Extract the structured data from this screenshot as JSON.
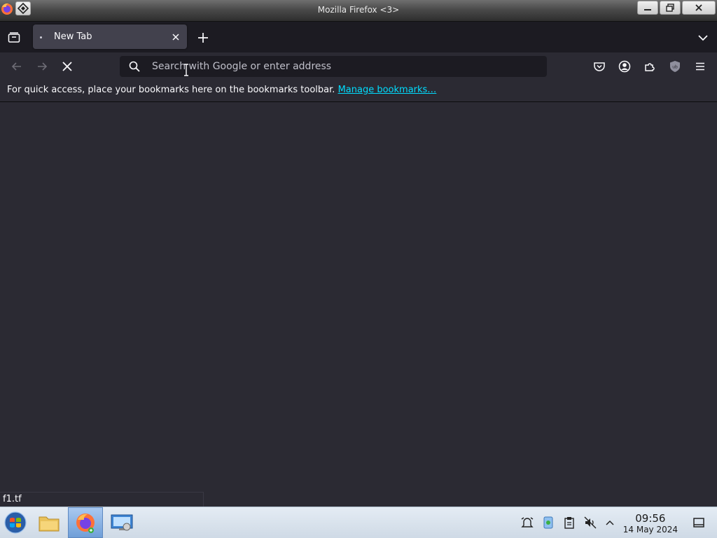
{
  "window": {
    "title": "Mozilla Firefox <3>"
  },
  "tabs": [
    {
      "label": "New Tab",
      "active": true
    }
  ],
  "navbar": {
    "url_placeholder": "Search with Google or enter address",
    "url_value": ""
  },
  "bookmarks_bar": {
    "message": "For quick access, place your bookmarks here on the bookmarks toolbar.",
    "link_label": "Manage bookmarks…"
  },
  "status_link": "f1.tf",
  "taskbar": {
    "time": "09:56",
    "date": "14 May 2024"
  },
  "colors": {
    "accent_link": "#00ddff",
    "chrome_bg": "#2b2a33",
    "toolbar_dark": "#1c1b22"
  },
  "icons": [
    "firefox-icon",
    "pin-icon",
    "minimize-icon",
    "maximize-icon",
    "close-icon",
    "tab-list-icon",
    "tab-close-icon",
    "new-tab-icon",
    "list-all-tabs-icon",
    "back-icon",
    "forward-icon",
    "stop-icon",
    "search-icon",
    "pocket-icon",
    "account-icon",
    "extensions-icon",
    "ublock-icon",
    "menu-icon",
    "start-menu-icon",
    "file-manager-icon",
    "firefox-taskbar-icon",
    "system-settings-icon",
    "notifications-icon",
    "updater-icon",
    "clipboard-icon",
    "volume-muted-icon",
    "tray-expand-icon",
    "show-desktop-icon"
  ]
}
